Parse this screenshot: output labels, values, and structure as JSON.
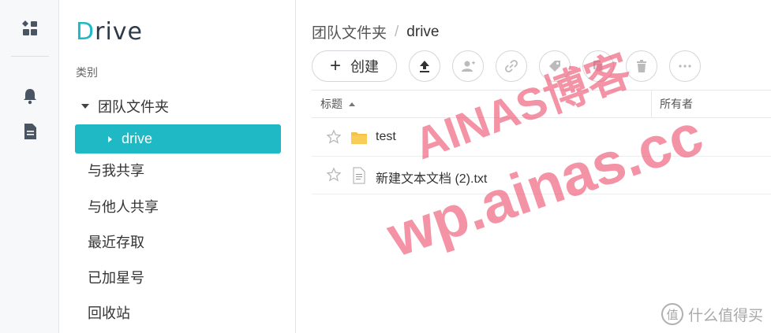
{
  "rail": {
    "icons": [
      "dashboard-icon",
      "bell-icon",
      "document-icon"
    ]
  },
  "sidebar": {
    "logo_d": "D",
    "logo_rest": "rive",
    "category_title": "类别",
    "tree_root": "团队文件夹",
    "tree_active": "drive",
    "items": [
      {
        "label": "与我共享"
      },
      {
        "label": "与他人共享"
      },
      {
        "label": "最近存取"
      },
      {
        "label": "已加星号"
      },
      {
        "label": "回收站"
      }
    ]
  },
  "breadcrumb": {
    "parent": "团队文件夹",
    "separator": "/",
    "current": "drive"
  },
  "toolbar": {
    "create_label": "创建",
    "buttons": [
      "upload-icon",
      "add-user-icon",
      "link-icon",
      "tag-icon",
      "copy-icon",
      "delete-icon",
      "more-icon"
    ]
  },
  "table": {
    "col_name": "标题",
    "col_owner": "所有者",
    "rows": [
      {
        "name": "test",
        "type": "folder"
      },
      {
        "name": "新建文本文档 (2).txt",
        "type": "file"
      }
    ]
  },
  "watermark": {
    "line1": "AINAS博客",
    "line2": "wp.ainas.cc"
  },
  "brand": {
    "badge": "值",
    "text": "什么值得买"
  },
  "colors": {
    "accent": "#1fb9c6",
    "folder": "#f7c244",
    "watermark": "#ee506e"
  }
}
